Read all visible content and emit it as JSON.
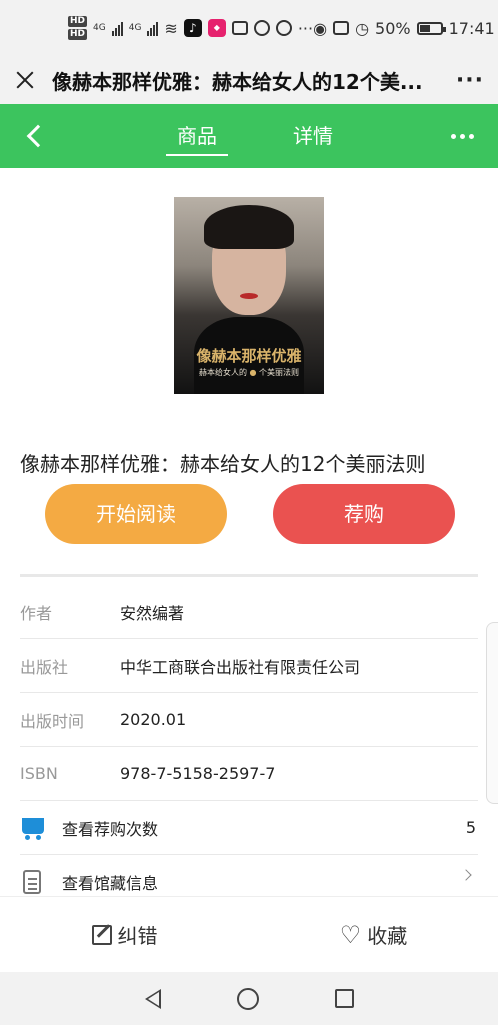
{
  "status_bar": {
    "time": "17:41",
    "battery": "50%",
    "network_1": "4G",
    "network_2": "4G",
    "overflow": "···"
  },
  "title_bar": {
    "title": "像赫本那样优雅：赫本给女人的12个美...",
    "more": "···"
  },
  "nav": {
    "tabs": [
      {
        "label": "商品",
        "active": true
      },
      {
        "label": "详情",
        "active": false
      }
    ]
  },
  "cover": {
    "title": "像赫本那样优雅",
    "subtitle_pre": "赫本给女人的",
    "subtitle_post": "个美丽法则"
  },
  "book": {
    "title": "像赫本那样优雅：赫本给女人的12个美丽法则"
  },
  "actions": {
    "read_label": "开始阅读",
    "buy_label": "荐购"
  },
  "info": [
    {
      "label": "作者",
      "value": "安然编著"
    },
    {
      "label": "出版社",
      "value": "中华工商联合出版社有限责任公司"
    },
    {
      "label": "出版时间",
      "value": "2020.01"
    },
    {
      "label": "ISBN",
      "value": "978-7-5158-2597-7"
    }
  ],
  "links": {
    "recommend_count_label": "查看荐购次数",
    "recommend_count": "5",
    "holdings_label": "查看馆藏信息"
  },
  "bottom_bar": {
    "correct_label": "纠错",
    "favorite_label": "收藏"
  },
  "colors": {
    "nav_green": "#3cc45e",
    "read_orange": "#f4aa43",
    "buy_red": "#ea5250",
    "cart_blue": "#1e8ed8"
  },
  "icons": [
    "close-icon",
    "more-icon",
    "back-chevron-icon",
    "cart-icon",
    "document-icon",
    "chevron-right-icon",
    "edit-icon",
    "heart-icon"
  ]
}
